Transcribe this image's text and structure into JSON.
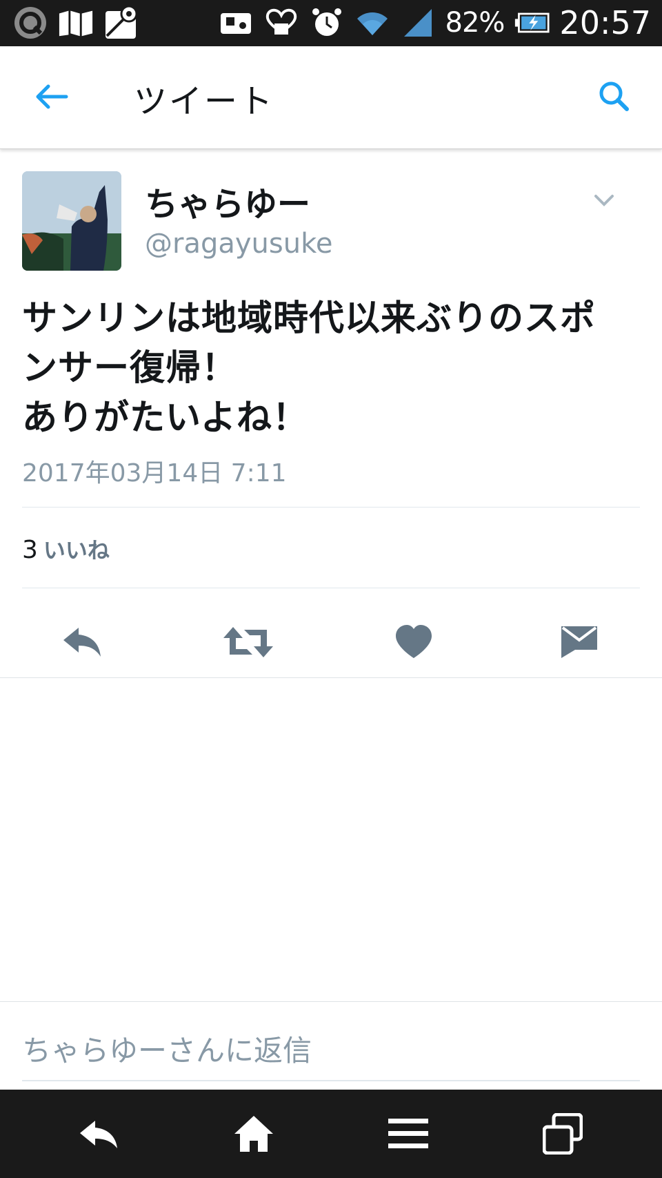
{
  "status_bar": {
    "battery": "82%",
    "time": "20:57",
    "left_icons": [
      "q-icon",
      "map-folder-icon",
      "maps-icon"
    ],
    "right_icons": [
      "wallet-icon",
      "heart-mail-icon",
      "alarm-icon",
      "wifi-icon",
      "signal-icon",
      "battery-icon"
    ]
  },
  "toolbar": {
    "title": "ツイート"
  },
  "tweet": {
    "display_name": "ちゃらゆー",
    "handle": "@ragayusuke",
    "text_lines": [
      "サンリンは地域時代以来ぶりのスポ",
      "ンサー復帰！",
      "ありがたいよね！"
    ],
    "timestamp": "2017年03月14日 7:11",
    "like_count": "3",
    "like_label": "いいね"
  },
  "reply": {
    "placeholder": "ちゃらゆーさんに返信"
  },
  "colors": {
    "accent": "#1da1f2",
    "icon_gray": "#657786",
    "muted_text": "#8899a6"
  }
}
